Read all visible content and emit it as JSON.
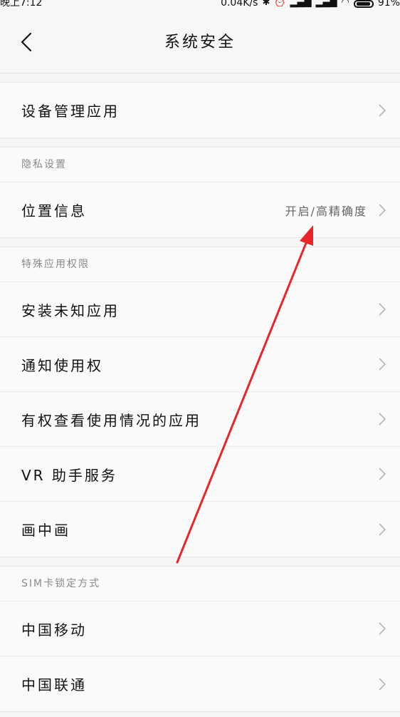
{
  "status_bar": {
    "time": "晚上7:12",
    "network_speed": "0.04K/s",
    "battery_percent": "91%",
    "icons": [
      "bluetooth-icon",
      "alarm-icon",
      "signal-icon",
      "signal-icon",
      "wifi-icon",
      "battery-icon"
    ]
  },
  "header": {
    "title": "系统安全",
    "back_icon": "chevron-left-icon"
  },
  "groups": {
    "device": {
      "items": [
        {
          "label": "设备管理应用"
        }
      ]
    },
    "privacy": {
      "label": "隐私设置",
      "items": [
        {
          "label": "位置信息",
          "value": "开启/高精确度"
        }
      ]
    },
    "special": {
      "label": "特殊应用权限",
      "items": [
        {
          "label": "安装未知应用"
        },
        {
          "label": "通知使用权"
        },
        {
          "label": "有权查看使用情况的应用"
        },
        {
          "label": "VR 助手服务"
        },
        {
          "label": "画中画"
        }
      ]
    },
    "sim": {
      "label": "SIM卡锁定方式",
      "items": [
        {
          "label": "中国移动"
        },
        {
          "label": "中国联通"
        }
      ]
    }
  },
  "colors": {
    "annotation_arrow": "#e8262a",
    "background": "#f5f5f5"
  }
}
